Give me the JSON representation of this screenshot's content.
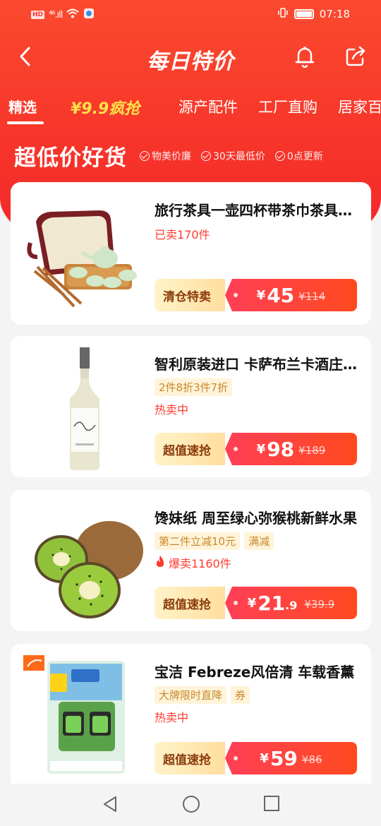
{
  "status_bar": {
    "hd": "HD",
    "signal": "⁴⁶.ıll",
    "time": "07:18"
  },
  "header": {
    "title": "每日特价",
    "back_icon": "chevron-left-icon",
    "bell_icon": "bell-icon",
    "share_icon": "share-icon"
  },
  "tabs": [
    {
      "label": "精选",
      "active": true
    },
    {
      "label": "¥9.9疯抢",
      "style": "hot"
    },
    {
      "label": "源产配件"
    },
    {
      "label": "工厂直购"
    },
    {
      "label": "居家百"
    }
  ],
  "section": {
    "title": "超低价好货",
    "tags": [
      "物美价廉",
      "30天最低价",
      "0点更新"
    ]
  },
  "products": [
    {
      "title": "旅行茶具一壶四杯带茶巾茶具收纳包",
      "chips": [],
      "sold": "已卖170件",
      "sold_hot": false,
      "action": "清仓特卖",
      "currency": "¥",
      "price_int": "45",
      "price_dec": "",
      "orig": "¥114",
      "image": "tea-set-image"
    },
    {
      "title": "智利原装进口 卡萨布兰卡酒庄白葡萄酒",
      "chips": [
        "2件8折3件7折"
      ],
      "sold": "热卖中",
      "sold_hot": false,
      "action": "超值速抢",
      "currency": "¥",
      "price_int": "98",
      "price_dec": "",
      "orig": "¥189",
      "image": "wine-bottle-image"
    },
    {
      "title": "馋妹纸 周至绿心弥猴桃新鲜水果",
      "chips": [
        "第二件立减10元",
        "满减"
      ],
      "sold": "爆卖1160件",
      "sold_hot": true,
      "action": "超值速抢",
      "currency": "¥",
      "price_int": "21",
      "price_dec": ".9",
      "orig": "¥39.9",
      "image": "kiwi-image"
    },
    {
      "title": "宝洁 Febreze风倍清 车载香薰",
      "chips": [
        "大牌限时直降",
        "券"
      ],
      "sold": "热卖中",
      "sold_hot": false,
      "action": "超值速抢",
      "currency": "¥",
      "price_int": "59",
      "price_dec": "",
      "orig": "¥86",
      "image": "car-freshener-image"
    }
  ],
  "colors": {
    "brand_red": "#f6342a",
    "price_red": "#ff3f57",
    "hot_yellow": "#ffe14a",
    "chip_bg": "#fff4da"
  }
}
